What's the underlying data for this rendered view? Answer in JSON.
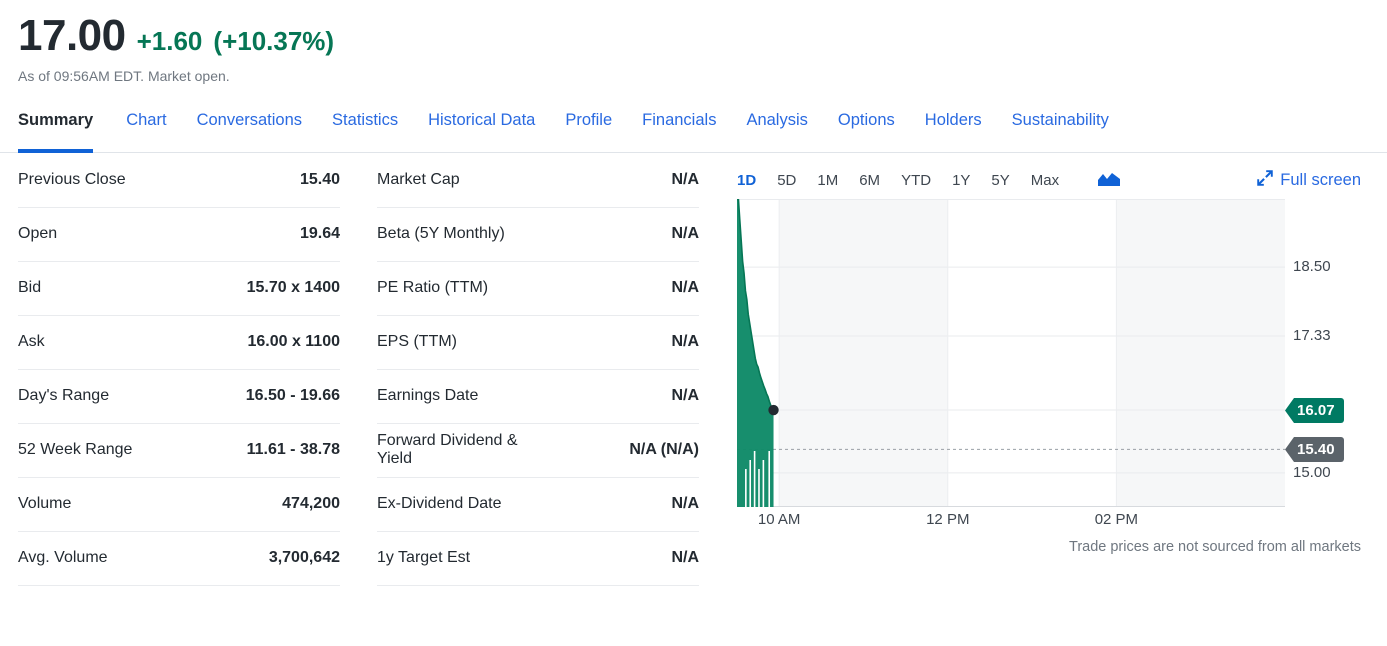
{
  "quote": {
    "price": "17.00",
    "change": "+1.60",
    "change_percent": "(+10.37%)",
    "meta": "As of 09:56AM EDT. Market open.",
    "positive_color": "#067655"
  },
  "tabs": [
    {
      "label": "Summary",
      "active": true
    },
    {
      "label": "Chart",
      "active": false
    },
    {
      "label": "Conversations",
      "active": false
    },
    {
      "label": "Statistics",
      "active": false
    },
    {
      "label": "Historical Data",
      "active": false
    },
    {
      "label": "Profile",
      "active": false
    },
    {
      "label": "Financials",
      "active": false
    },
    {
      "label": "Analysis",
      "active": false
    },
    {
      "label": "Options",
      "active": false
    },
    {
      "label": "Holders",
      "active": false
    },
    {
      "label": "Sustainability",
      "active": false
    }
  ],
  "quote_table_left": [
    {
      "label": "Previous Close",
      "value": "15.40"
    },
    {
      "label": "Open",
      "value": "19.64"
    },
    {
      "label": "Bid",
      "value": "15.70 x 1400"
    },
    {
      "label": "Ask",
      "value": "16.00 x 1100"
    },
    {
      "label": "Day's Range",
      "value": "16.50 - 19.66"
    },
    {
      "label": "52 Week Range",
      "value": "11.61 - 38.78"
    },
    {
      "label": "Volume",
      "value": "474,200"
    },
    {
      "label": "Avg. Volume",
      "value": "3,700,642"
    }
  ],
  "quote_table_right": [
    {
      "label": "Market Cap",
      "value": "N/A"
    },
    {
      "label": "Beta (5Y Monthly)",
      "value": "N/A"
    },
    {
      "label": "PE Ratio (TTM)",
      "value": "N/A"
    },
    {
      "label": "EPS (TTM)",
      "value": "N/A"
    },
    {
      "label": "Earnings Date",
      "value": "N/A"
    },
    {
      "label": "Forward Dividend & Yield",
      "value": "N/A (N/A)"
    },
    {
      "label": "Ex-Dividend Date",
      "value": "N/A"
    },
    {
      "label": "1y Target Est",
      "value": "N/A"
    }
  ],
  "chart_toolbar": {
    "ranges": [
      {
        "label": "1D",
        "active": true
      },
      {
        "label": "5D",
        "active": false
      },
      {
        "label": "1M",
        "active": false
      },
      {
        "label": "6M",
        "active": false
      },
      {
        "label": "YTD",
        "active": false
      },
      {
        "label": "1Y",
        "active": false
      },
      {
        "label": "5Y",
        "active": false
      },
      {
        "label": "Max",
        "active": false
      }
    ],
    "chart_type_icon": "area-chart-icon",
    "fullscreen_icon": "expand-arrows-icon",
    "fullscreen_label": "Full screen"
  },
  "chart_footnote": "Trade prices are not sourced from all markets",
  "chart_data": {
    "type": "area",
    "title": "",
    "xlabel": "",
    "ylabel": "",
    "grid": true,
    "legend_position": "none",
    "line_color": "#067655",
    "fill_color": "#0f8a68",
    "ylim": [
      14.42,
      19.66
    ],
    "ytick_labels": [
      "18.50",
      "17.33",
      "15.00"
    ],
    "ytick_values": [
      18.5,
      17.33,
      15.0
    ],
    "gridline_values": [
      18.5,
      17.33,
      16.07,
      15.0
    ],
    "xtick_labels": [
      "10 AM",
      "12 PM",
      "02 PM"
    ],
    "xtick_times": [
      "10:00",
      "12:00",
      "14:00"
    ],
    "session_start": "09:30",
    "session_end": "16:00",
    "last_price_marker": 16.07,
    "previous_close_line": 15.4,
    "price_tags": [
      {
        "label": "16.07",
        "value": 16.07,
        "color": "#007a63",
        "kind": "last-price"
      },
      {
        "label": "15.40",
        "value": 15.4,
        "color": "#5b636a",
        "kind": "previous-close"
      }
    ],
    "x": [
      "09:30",
      "09:31",
      "09:32",
      "09:33",
      "09:34",
      "09:35",
      "09:36",
      "09:37",
      "09:38",
      "09:39",
      "09:40",
      "09:41",
      "09:42",
      "09:43",
      "09:44",
      "09:45",
      "09:46",
      "09:47",
      "09:48",
      "09:49",
      "09:50",
      "09:51",
      "09:52",
      "09:53",
      "09:54",
      "09:55",
      "09:56"
    ],
    "values": [
      19.64,
      19.66,
      19.3,
      18.95,
      18.6,
      18.4,
      18.1,
      17.95,
      17.7,
      17.55,
      17.4,
      17.25,
      17.1,
      16.95,
      16.85,
      16.8,
      16.7,
      16.62,
      16.55,
      16.48,
      16.42,
      16.35,
      16.3,
      16.22,
      16.15,
      16.1,
      16.07
    ]
  }
}
